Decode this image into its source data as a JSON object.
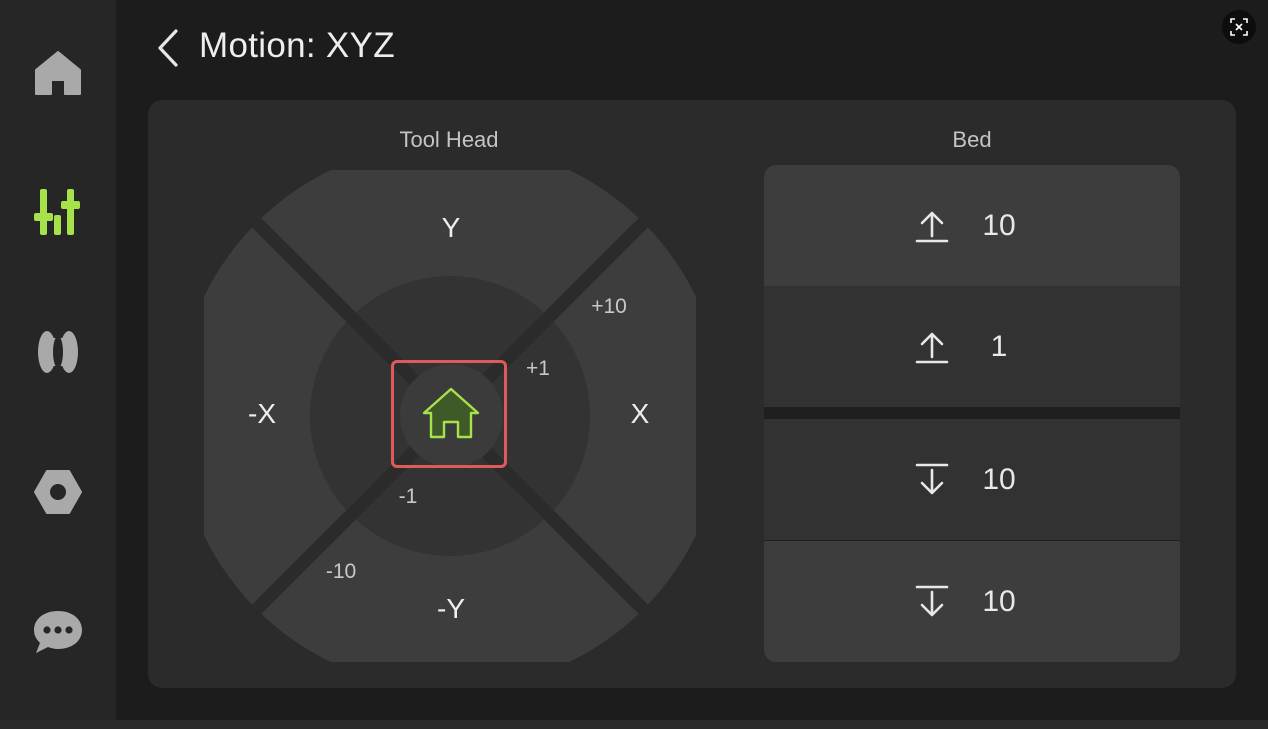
{
  "sidebar": {
    "items": [
      {
        "name": "home",
        "icon": "home-icon"
      },
      {
        "name": "tune",
        "icon": "sliders-icon",
        "active": true
      },
      {
        "name": "filament",
        "icon": "filament-spool-icon"
      },
      {
        "name": "settings",
        "icon": "nut-icon"
      },
      {
        "name": "messages",
        "icon": "chat-bubble-icon"
      }
    ],
    "active_color": "#a6e24a",
    "inactive_color": "#a9a9a9"
  },
  "header": {
    "title": "Motion: XYZ",
    "back_icon": "chevron-left-icon",
    "screenshot_icon": "screenshot-icon"
  },
  "toolhead": {
    "label": "Tool Head",
    "directions": {
      "up": "Y",
      "down": "-Y",
      "left": "-X",
      "right": "X"
    },
    "outer_step_plus": "+10",
    "outer_step_minus": "-10",
    "inner_step_plus": "+1",
    "inner_step_minus": "-1",
    "home_icon": "home-icon",
    "home_color": "#a6e24a"
  },
  "bed": {
    "label": "Bed",
    "buttons": [
      {
        "icon": "arrow-up-icon",
        "value": "10"
      },
      {
        "icon": "arrow-up-icon",
        "value": "1"
      },
      {
        "icon": "arrow-down-icon",
        "value": "10"
      },
      {
        "icon": "arrow-down-icon",
        "value": "10"
      }
    ]
  }
}
